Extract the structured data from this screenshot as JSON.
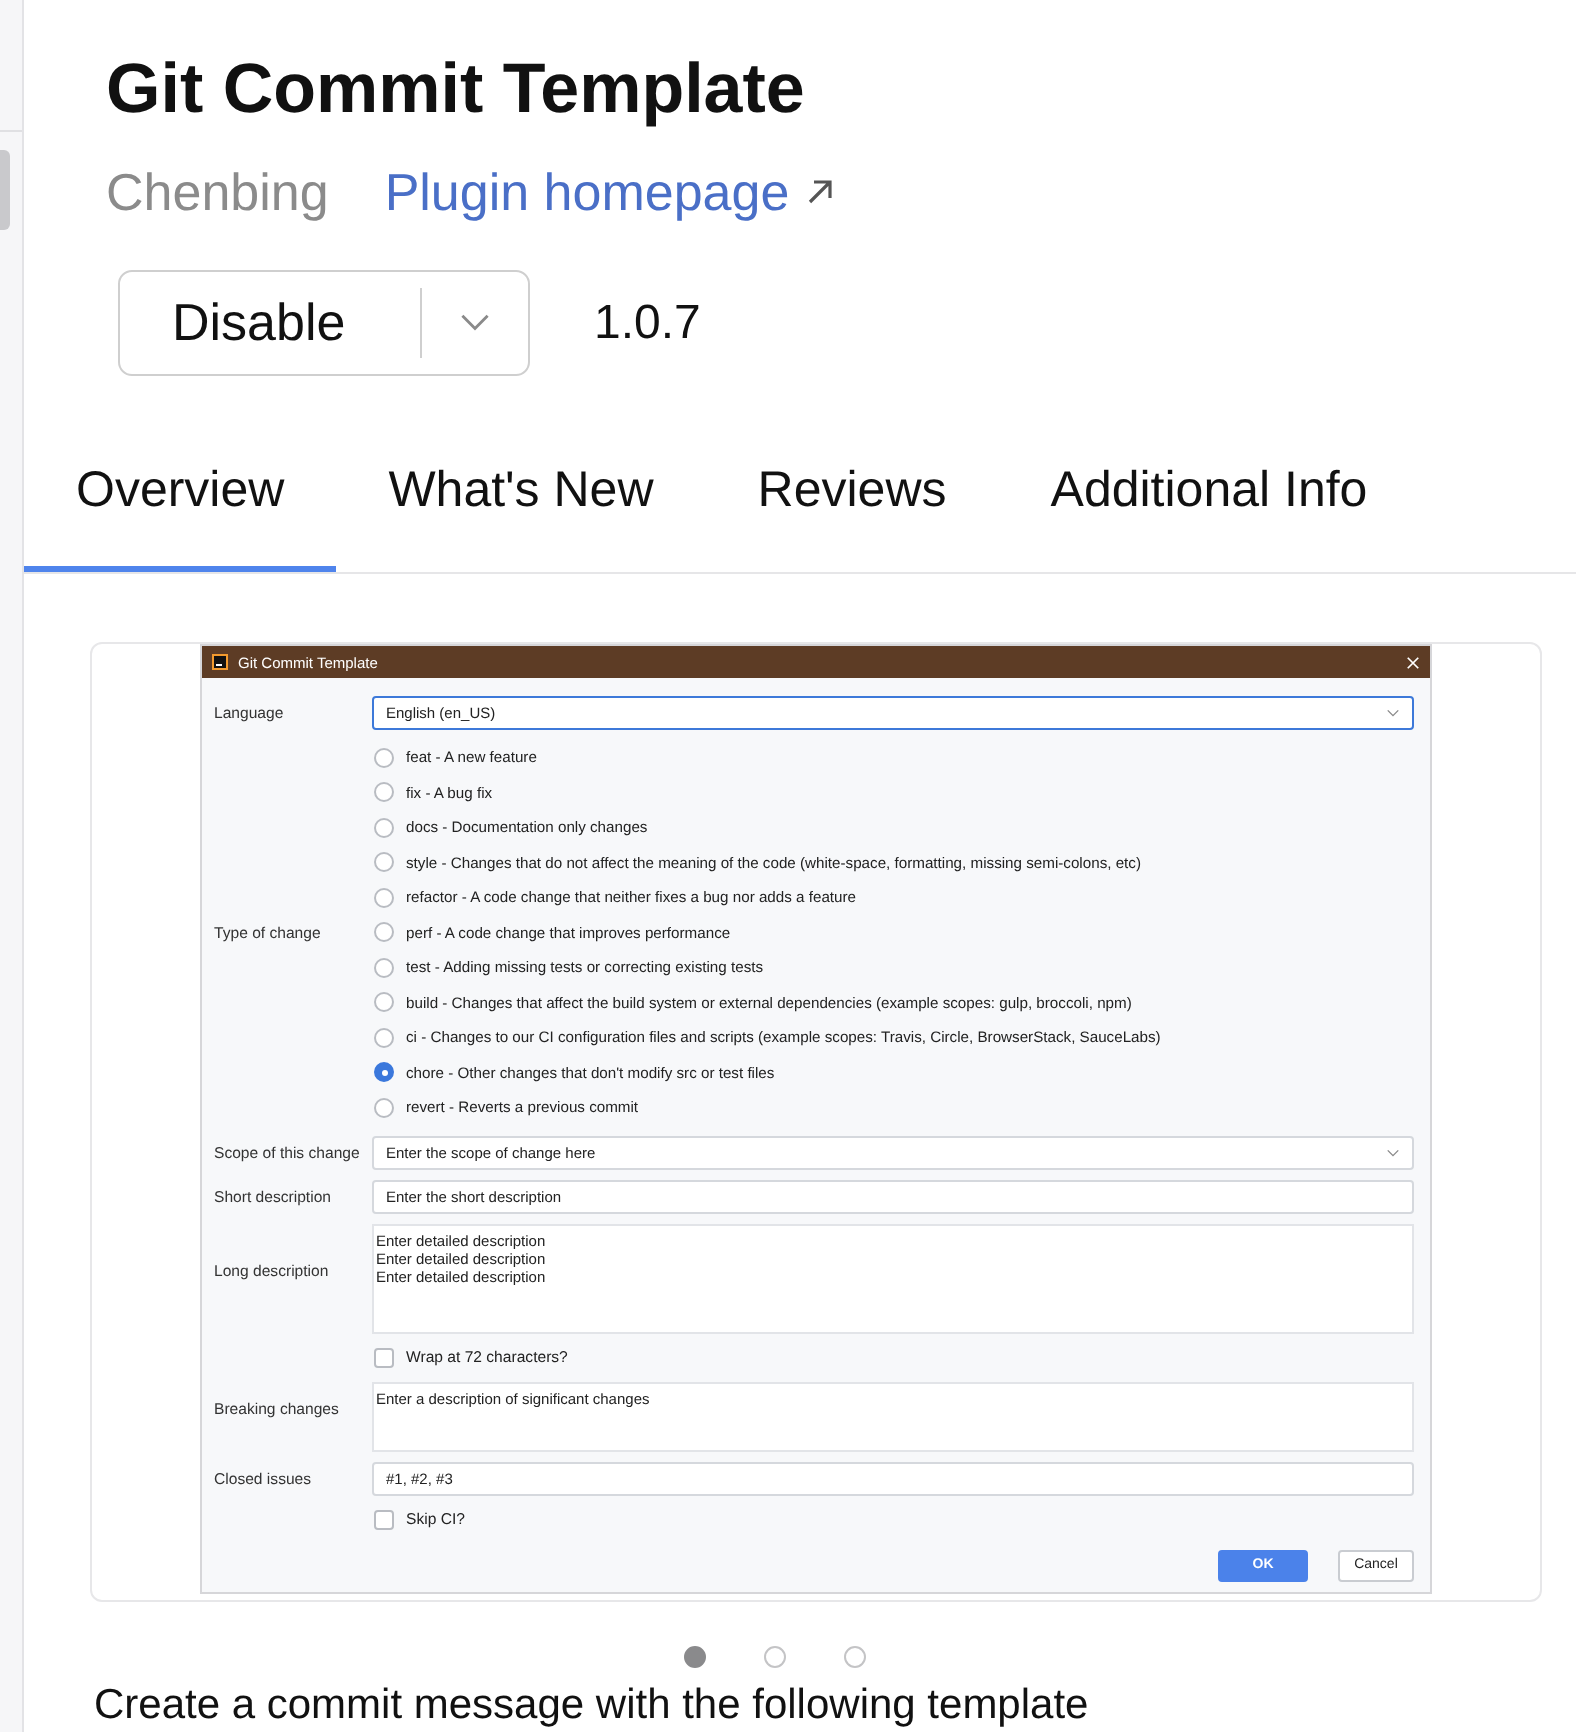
{
  "header": {
    "title": "Git Commit Template",
    "vendor": "Chenbing",
    "homepage_link": "Plugin homepage",
    "action_button": "Disable",
    "version": "1.0.7"
  },
  "tabs": [
    {
      "label": "Overview",
      "selected": true
    },
    {
      "label": "What's New",
      "selected": false
    },
    {
      "label": "Reviews",
      "selected": false
    },
    {
      "label": "Additional Info",
      "selected": false
    }
  ],
  "screenshots": {
    "dialog": {
      "title": "Git Commit Template",
      "rows": [
        {
          "kind": "select",
          "label": "Language",
          "value": "English (en_US)",
          "focused": true
        },
        {
          "kind": "radios",
          "label": "Type of change",
          "options": [
            {
              "label": "feat - A new feature",
              "selected": false
            },
            {
              "label": "fix - A bug fix",
              "selected": false
            },
            {
              "label": "docs - Documentation only changes",
              "selected": false
            },
            {
              "label": "style - Changes that do not affect the meaning of the code (white-space, formatting, missing semi-colons, etc)",
              "selected": false
            },
            {
              "label": "refactor - A code change that neither fixes a bug nor adds a feature",
              "selected": false
            },
            {
              "label": "perf - A code change that improves performance",
              "selected": false
            },
            {
              "label": "test - Adding missing tests or correcting existing tests",
              "selected": false
            },
            {
              "label": "build - Changes that affect the build system or external dependencies (example scopes: gulp, broccoli, npm)",
              "selected": false
            },
            {
              "label": "ci - Changes to our CI configuration files and scripts (example scopes: Travis, Circle, BrowserStack, SauceLabs)",
              "selected": false
            },
            {
              "label": "chore - Other changes that don't modify src or test files",
              "selected": true
            },
            {
              "label": "revert - Reverts a previous commit",
              "selected": false
            }
          ]
        },
        {
          "kind": "select",
          "label": "Scope of this change",
          "value": "Enter the scope of change here",
          "focused": false
        },
        {
          "kind": "input",
          "label": "Short description",
          "value": "Enter the short description",
          "focused": false
        },
        {
          "kind": "textarea",
          "label": "Long description",
          "value": "Enter detailed description\nEnter detailed description\nEnter detailed description",
          "focused": false
        },
        {
          "kind": "checkbox",
          "label": "Wrap at 72 characters?",
          "checked": false
        },
        {
          "kind": "textarea",
          "label": "Breaking changes",
          "value": "Enter a description of significant changes",
          "focused": false
        },
        {
          "kind": "input",
          "label": "Closed issues",
          "value": "#1, #2, #3",
          "focused": false
        },
        {
          "kind": "checkbox",
          "label": "Skip CI?",
          "checked": false
        }
      ],
      "buttons": [
        {
          "label": "OK",
          "kind": "primary"
        },
        {
          "label": "Cancel",
          "kind": "secondary"
        }
      ]
    },
    "pages": [
      {
        "selected": true
      },
      {
        "selected": false
      },
      {
        "selected": false
      }
    ]
  },
  "description": "Create a commit message with the following template"
}
